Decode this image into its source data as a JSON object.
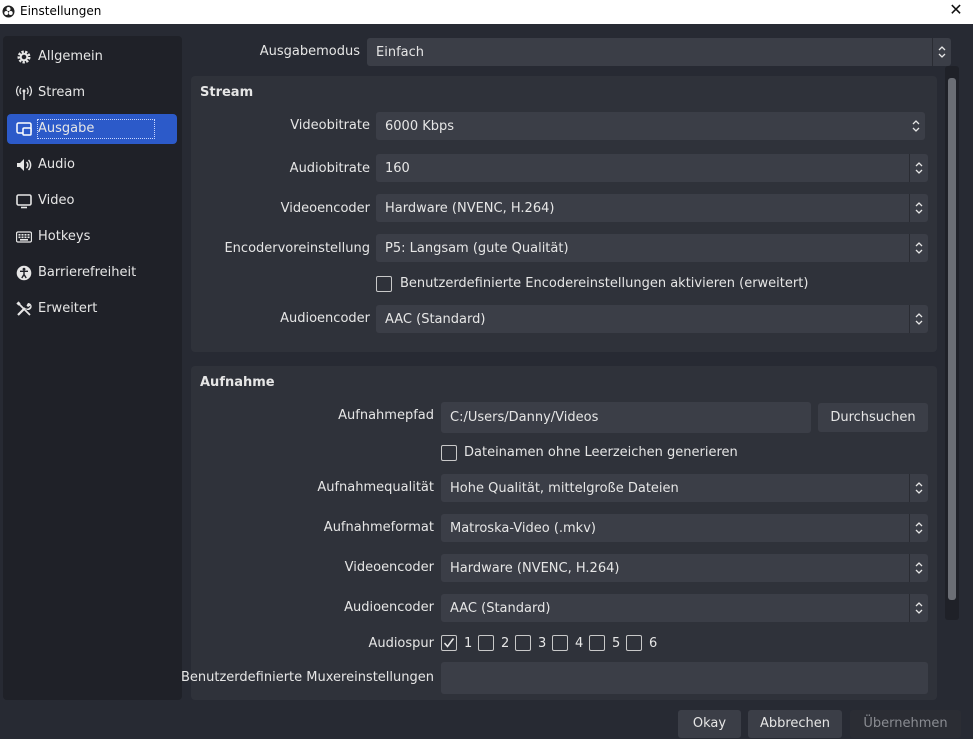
{
  "window": {
    "title": "Einstellungen",
    "close_icon": "close-icon"
  },
  "sidebar": {
    "items": [
      {
        "label": "Allgemein",
        "icon": "gear-icon"
      },
      {
        "label": "Stream",
        "icon": "antenna-icon"
      },
      {
        "label": "Ausgabe",
        "icon": "output-icon",
        "active": true
      },
      {
        "label": "Audio",
        "icon": "speaker-icon"
      },
      {
        "label": "Video",
        "icon": "monitor-icon"
      },
      {
        "label": "Hotkeys",
        "icon": "keyboard-icon"
      },
      {
        "label": "Barrierefreiheit",
        "icon": "accessibility-icon"
      },
      {
        "label": "Erweitert",
        "icon": "tools-icon"
      }
    ]
  },
  "output_mode": {
    "label": "Ausgabemodus",
    "value": "Einfach"
  },
  "stream": {
    "title": "Stream",
    "video_bitrate": {
      "label": "Videobitrate",
      "value": "6000 Kbps"
    },
    "audio_bitrate": {
      "label": "Audiobitrate",
      "value": "160"
    },
    "video_encoder": {
      "label": "Videoencoder",
      "value": "Hardware (NVENC, H.264)"
    },
    "encoder_preset": {
      "label": "Encodervoreinstellung",
      "value": "P5: Langsam (gute Qualität)"
    },
    "custom_encoder_settings": {
      "label": "Benutzerdefinierte Encodereinstellungen aktivieren (erweitert)",
      "checked": false
    },
    "audio_encoder": {
      "label": "Audioencoder",
      "value": "AAC (Standard)"
    }
  },
  "recording": {
    "title": "Aufnahme",
    "path": {
      "label": "Aufnahmepfad",
      "value": "C:/Users/Danny/Videos",
      "browse_label": "Durchsuchen"
    },
    "no_spaces": {
      "label": "Dateinamen ohne Leerzeichen generieren",
      "checked": false
    },
    "quality": {
      "label": "Aufnahmequalität",
      "value": "Hohe Qualität, mittelgroße Dateien"
    },
    "format": {
      "label": "Aufnahmeformat",
      "value": "Matroska-Video (.mkv)"
    },
    "video_encoder": {
      "label": "Videoencoder",
      "value": "Hardware (NVENC, H.264)"
    },
    "audio_encoder": {
      "label": "Audioencoder",
      "value": "AAC (Standard)"
    },
    "audio_tracks": {
      "label": "Audiospur",
      "tracks": [
        {
          "label": "1",
          "checked": true
        },
        {
          "label": "2",
          "checked": false
        },
        {
          "label": "3",
          "checked": false
        },
        {
          "label": "4",
          "checked": false
        },
        {
          "label": "5",
          "checked": false
        },
        {
          "label": "6",
          "checked": false
        }
      ]
    },
    "muxer": {
      "label": "Benutzerdefinierte Muxereinstellungen",
      "value": ""
    }
  },
  "footer": {
    "ok_label": "Okay",
    "cancel_label": "Abbrechen",
    "apply_label": "Übernehmen"
  },
  "colors": {
    "accent": "#2c5ac9",
    "background": "#272a33",
    "panel": "#2f323a",
    "input": "#3b3e47"
  }
}
